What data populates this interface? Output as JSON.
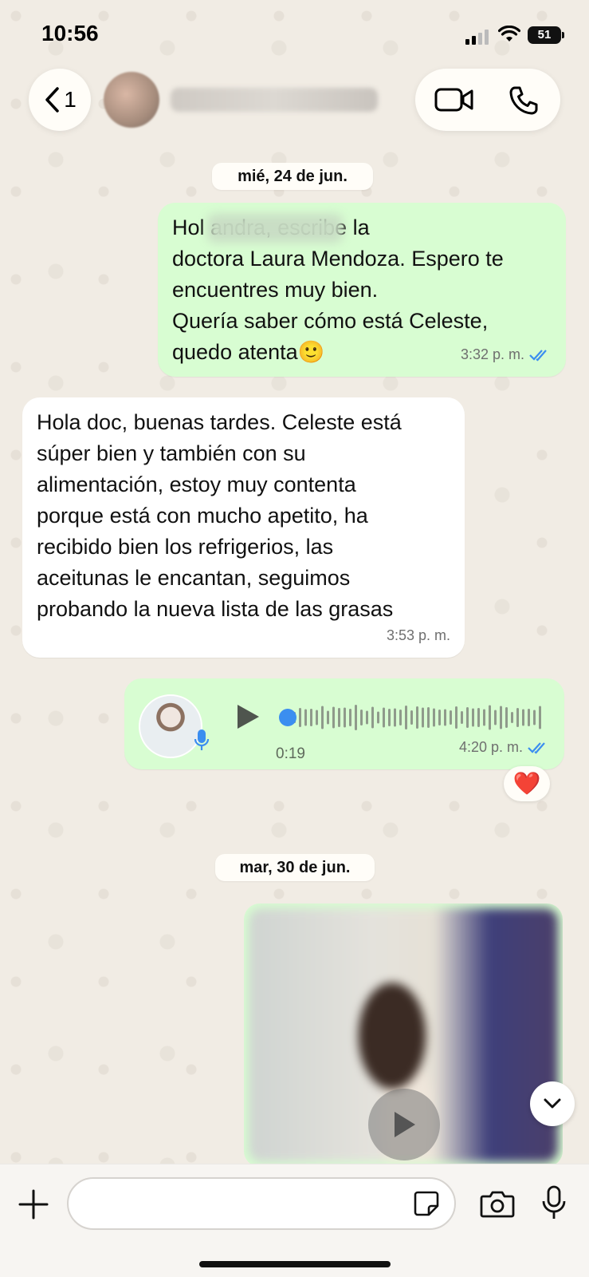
{
  "status_bar": {
    "time": "10:56",
    "battery": "51"
  },
  "header": {
    "back_count": "1",
    "contact_name": "",
    "icons": {
      "back": "chevron-left-icon",
      "video": "video-camera-icon",
      "phone": "phone-icon"
    }
  },
  "messages": [
    {
      "type": "date",
      "label": "mié, 24 de jun."
    },
    {
      "type": "outgoing",
      "text": "Hol          andra, escribe la\ndoctora Laura Mendoza. Espero te\nencuentres muy bien.\nQuería saber cómo está Celeste,\nquedo atenta🙂",
      "time": "3:32 p. m.",
      "status": "read"
    },
    {
      "type": "incoming",
      "text": "Hola doc, buenas tardes. Celeste está\nsúper bien y también con su\nalimentación, estoy muy contenta\nporque está con mucho apetito, ha\nrecibido bien los refrigerios, las\naceitunas le encantan, seguimos\nprobando la nueva lista de las grasas",
      "time": "3:53 p. m."
    },
    {
      "type": "voice",
      "duration": "0:19",
      "time": "4:20 p. m.",
      "status": "read",
      "reaction": "❤️"
    },
    {
      "type": "date",
      "label": "mar, 30 de jun."
    },
    {
      "type": "video"
    }
  ],
  "composer": {
    "placeholder": ""
  },
  "colors": {
    "outgoing": "#d8fdd2",
    "incoming": "#ffffff",
    "read_tick": "#3b8ef0",
    "background": "#f1ece4"
  }
}
